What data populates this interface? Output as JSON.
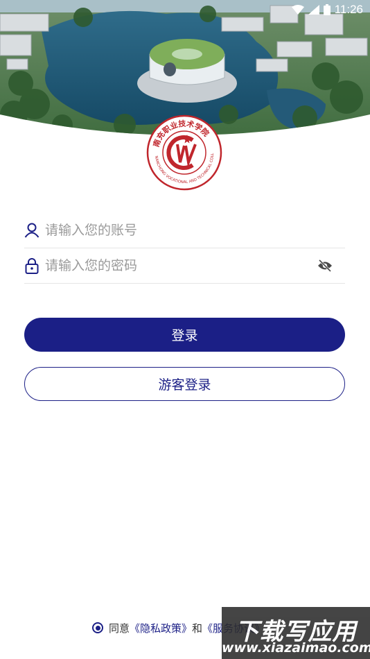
{
  "status_bar": {
    "time": "11:26",
    "icons": [
      "wifi-icon",
      "signal-icon",
      "battery-icon"
    ]
  },
  "logo": {
    "name": "school-logo",
    "arc_text": "南充职业技术学院",
    "english_text": "NANCHONG VOCATIONAL AND TECHNICAL COLLEGE",
    "colors": {
      "primary": "#c0262c"
    }
  },
  "form": {
    "account": {
      "placeholder": "请输入您的账号",
      "value": "",
      "icon": "user-icon"
    },
    "password": {
      "placeholder": "请输入您的密码",
      "value": "",
      "icon": "lock-icon",
      "toggle_icon": "eye-off-icon"
    }
  },
  "buttons": {
    "login": "登录",
    "guest": "游客登录"
  },
  "agreement": {
    "prefix": "同意",
    "privacy": "《隐私政策》",
    "and": "和",
    "service": "《服务协议》"
  },
  "watermark": {
    "top": "下载写应用",
    "bottom": "www.xiazaimao.com"
  },
  "colors": {
    "accent": "#1b1f86",
    "logo_red": "#c0262c"
  }
}
